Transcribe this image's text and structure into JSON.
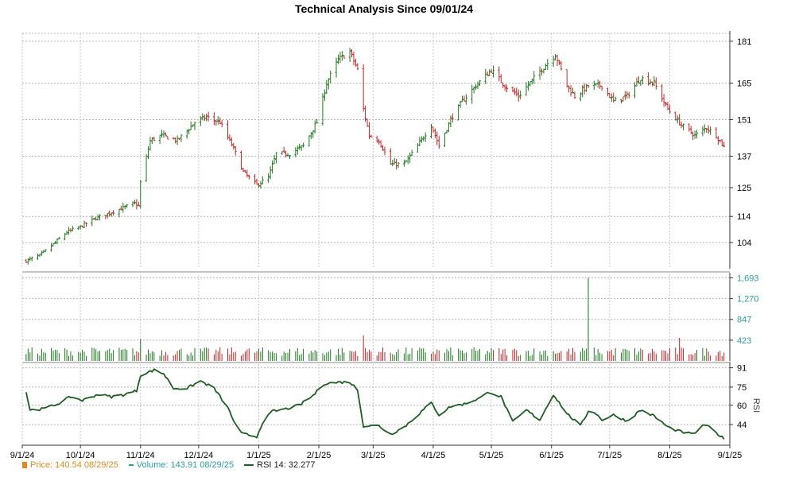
{
  "chart_data": {
    "type": "line",
    "title": "Technical Analysis Since 09/01/24",
    "x_tick_labels": [
      "9/1/24",
      "10/1/24",
      "11/1/24",
      "12/1/24",
      "1/1/25",
      "2/1/25",
      "3/1/25",
      "4/1/25",
      "5/1/25",
      "6/1/25",
      "7/1/25",
      "8/1/25",
      "9/1/25"
    ],
    "price_panel": {
      "type": "ohlc",
      "y_ticks": [
        "104",
        "114",
        "125",
        "137",
        "151",
        "165",
        "181"
      ],
      "ylim": [
        94,
        184
      ],
      "up_color": "#1a7a1a",
      "down_color": "#cc2222",
      "anchors": [
        [
          "2024-09-03",
          97
        ],
        [
          "2024-09-10",
          99
        ],
        [
          "2024-09-18",
          104
        ],
        [
          "2024-09-24",
          108
        ],
        [
          "2024-10-01",
          110
        ],
        [
          "2024-10-08",
          113
        ],
        [
          "2024-10-15",
          115
        ],
        [
          "2024-10-22",
          117
        ],
        [
          "2024-10-29",
          119
        ],
        [
          "2024-10-31",
          118
        ],
        [
          "2024-11-01",
          127
        ],
        [
          "2024-11-06",
          143
        ],
        [
          "2024-11-12",
          145
        ],
        [
          "2024-11-20",
          143
        ],
        [
          "2024-11-29",
          150
        ],
        [
          "2024-12-05",
          152
        ],
        [
          "2024-12-12",
          150
        ],
        [
          "2024-12-19",
          140
        ],
        [
          "2024-12-24",
          131
        ],
        [
          "2024-12-31",
          126
        ],
        [
          "2025-01-06",
          129
        ],
        [
          "2025-01-10",
          138
        ],
        [
          "2025-01-17",
          138
        ],
        [
          "2025-01-24",
          141
        ],
        [
          "2025-01-31",
          150
        ],
        [
          "2025-02-05",
          165
        ],
        [
          "2025-02-11",
          174
        ],
        [
          "2025-02-17",
          177
        ],
        [
          "2025-02-21",
          170
        ],
        [
          "2025-02-24",
          155
        ],
        [
          "2025-02-27",
          145
        ],
        [
          "2025-03-04",
          143
        ],
        [
          "2025-03-10",
          134
        ],
        [
          "2025-03-17",
          134
        ],
        [
          "2025-03-24",
          141
        ],
        [
          "2025-03-31",
          149
        ],
        [
          "2025-04-04",
          141
        ],
        [
          "2025-04-10",
          151
        ],
        [
          "2025-04-16",
          158
        ],
        [
          "2025-04-23",
          164
        ],
        [
          "2025-05-01",
          170
        ],
        [
          "2025-05-08",
          164
        ],
        [
          "2025-05-15",
          160
        ],
        [
          "2025-05-22",
          166
        ],
        [
          "2025-05-29",
          172
        ],
        [
          "2025-06-03",
          176
        ],
        [
          "2025-06-09",
          164
        ],
        [
          "2025-06-13",
          160
        ],
        [
          "2025-06-20",
          164
        ],
        [
          "2025-06-27",
          164
        ],
        [
          "2025-07-03",
          158
        ],
        [
          "2025-07-10",
          160
        ],
        [
          "2025-07-17",
          167
        ],
        [
          "2025-07-24",
          165
        ],
        [
          "2025-07-31",
          155
        ],
        [
          "2025-08-07",
          149
        ],
        [
          "2025-08-14",
          145
        ],
        [
          "2025-08-20",
          148
        ],
        [
          "2025-08-25",
          145
        ],
        [
          "2025-08-29",
          140.54
        ]
      ]
    },
    "volume_panel": {
      "type": "bar",
      "y_ticks": [
        "423",
        "847",
        "1,270",
        "1,693"
      ],
      "ylim": [
        0,
        1750
      ],
      "base_volume": 200,
      "spikes": [
        [
          "2024-11-01",
          450
        ],
        [
          "2025-02-24",
          520
        ],
        [
          "2025-06-20",
          1693
        ],
        [
          "2025-08-06",
          470
        ]
      ]
    },
    "rsi_panel": {
      "type": "line",
      "y_ticks": [
        "44",
        "60",
        "75",
        "91"
      ],
      "ylim": [
        27,
        94
      ],
      "ylabel": "RSI",
      "color": "#1b5e20",
      "anchors": [
        [
          "2024-09-03",
          71
        ],
        [
          "2024-09-05",
          56
        ],
        [
          "2024-09-12",
          57
        ],
        [
          "2024-09-19",
          61
        ],
        [
          "2024-09-26",
          67
        ],
        [
          "2024-10-02",
          64
        ],
        [
          "2024-10-10",
          69
        ],
        [
          "2024-10-17",
          67
        ],
        [
          "2024-10-24",
          69
        ],
        [
          "2024-10-30",
          72
        ],
        [
          "2024-11-01",
          85
        ],
        [
          "2024-11-08",
          89
        ],
        [
          "2024-11-13",
          86
        ],
        [
          "2024-11-18",
          74
        ],
        [
          "2024-11-25",
          74
        ],
        [
          "2024-12-02",
          80
        ],
        [
          "2024-12-09",
          74
        ],
        [
          "2024-12-16",
          58
        ],
        [
          "2024-12-22",
          37
        ],
        [
          "2024-12-31",
          34
        ],
        [
          "2025-01-03",
          46
        ],
        [
          "2025-01-08",
          55
        ],
        [
          "2025-01-15",
          57
        ],
        [
          "2025-01-22",
          60
        ],
        [
          "2025-01-29",
          68
        ],
        [
          "2025-02-04",
          78
        ],
        [
          "2025-02-11",
          79
        ],
        [
          "2025-02-17",
          79
        ],
        [
          "2025-02-21",
          73
        ],
        [
          "2025-02-24",
          43
        ],
        [
          "2025-03-04",
          43
        ],
        [
          "2025-03-10",
          36
        ],
        [
          "2025-03-17",
          42
        ],
        [
          "2025-03-24",
          52
        ],
        [
          "2025-03-31",
          62
        ],
        [
          "2025-04-04",
          52
        ],
        [
          "2025-04-10",
          59
        ],
        [
          "2025-04-17",
          61
        ],
        [
          "2025-04-25",
          66
        ],
        [
          "2025-04-30",
          71
        ],
        [
          "2025-05-06",
          67
        ],
        [
          "2025-05-12",
          46
        ],
        [
          "2025-05-19",
          56
        ],
        [
          "2025-05-26",
          48
        ],
        [
          "2025-06-02",
          69
        ],
        [
          "2025-06-09",
          53
        ],
        [
          "2025-06-16",
          43
        ],
        [
          "2025-06-21",
          58
        ],
        [
          "2025-06-27",
          48
        ],
        [
          "2025-07-03",
          52
        ],
        [
          "2025-07-10",
          47
        ],
        [
          "2025-07-17",
          56
        ],
        [
          "2025-07-24",
          51
        ],
        [
          "2025-07-31",
          42
        ],
        [
          "2025-08-07",
          38
        ],
        [
          "2025-08-13",
          36
        ],
        [
          "2025-08-19",
          44
        ],
        [
          "2025-08-22",
          41
        ],
        [
          "2025-08-29",
          32.277
        ]
      ]
    }
  },
  "legend": {
    "price_text": "Price: 140.54  08/29/25",
    "volume_text": "Volume: 143.91  08/29/25",
    "rsi_text": "RSI 14: 32.277"
  }
}
